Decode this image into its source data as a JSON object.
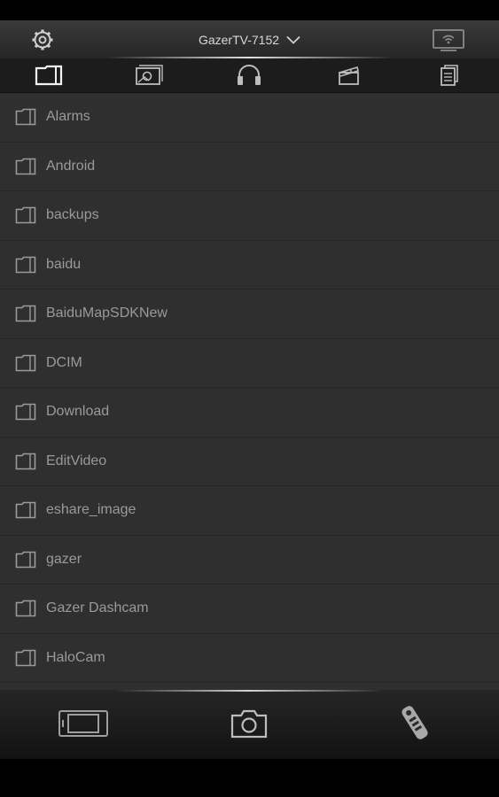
{
  "header": {
    "device_name": "GazerTV-7152",
    "settings_icon": "gear-icon",
    "cast_icon": "tv-wifi-icon"
  },
  "tabs": [
    {
      "icon": "folder-icon",
      "active": true
    },
    {
      "icon": "photo-icon",
      "active": false
    },
    {
      "icon": "headphones-icon",
      "active": false
    },
    {
      "icon": "clapperboard-icon",
      "active": false
    },
    {
      "icon": "document-icon",
      "active": false
    }
  ],
  "folders": [
    {
      "name": "Alarms"
    },
    {
      "name": "Android"
    },
    {
      "name": "backups"
    },
    {
      "name": "baidu"
    },
    {
      "name": "BaiduMapSDKNew"
    },
    {
      "name": "DCIM"
    },
    {
      "name": "Download"
    },
    {
      "name": "EditVideo"
    },
    {
      "name": "eshare_image"
    },
    {
      "name": "gazer"
    },
    {
      "name": "Gazer Dashcam"
    },
    {
      "name": "HaloCam"
    }
  ],
  "bottom_bar": [
    {
      "icon": "screen-mirror-icon"
    },
    {
      "icon": "camera-icon"
    },
    {
      "icon": "remote-control-icon"
    }
  ]
}
